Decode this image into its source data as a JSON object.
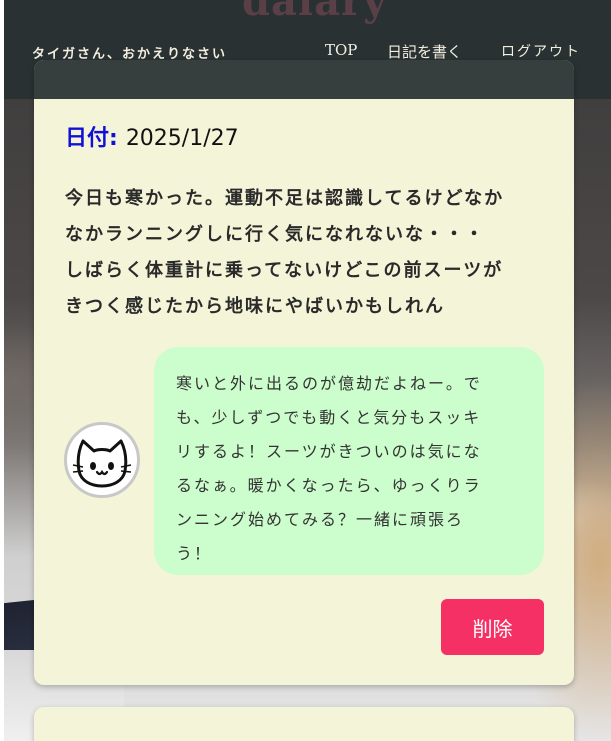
{
  "header": {
    "logo_text": "daiary",
    "greeting": "タイガさん、おかえりなさい",
    "nav": {
      "top": "TOP",
      "write": "日記を書く",
      "logout": "ログアウト"
    }
  },
  "entry": {
    "date_label": "日付:",
    "date_value": "2025/1/27",
    "lines": [
      "今日も寒かった。運動不足は認識してるけどなか",
      "なかランニングしに行く気になれないな・・・",
      "しばらく体重計に乗ってないけどこの前スーツが",
      "きつく感じたから地味にやばいかもしれん"
    ]
  },
  "reply": {
    "avatar_icon": "cat-face-icon",
    "lines": [
      "寒いと外に出るのが億劫だよねー。で",
      "も、少しずつでも動くと気分もスッキ",
      "リするよ！スーツがきついのは気にな",
      "るなぁ。暖かくなったら、ゆっくりラ",
      "ンニング始めてみる？一緒に頑張ろ",
      "う！"
    ]
  },
  "actions": {
    "delete_label": "削除"
  },
  "colors": {
    "header_bg": "#283032",
    "card_bg": "#f4f4d9",
    "date_label": "#1010d8",
    "bubble_bg": "#ccfdcc",
    "delete_button": "#f43064"
  }
}
